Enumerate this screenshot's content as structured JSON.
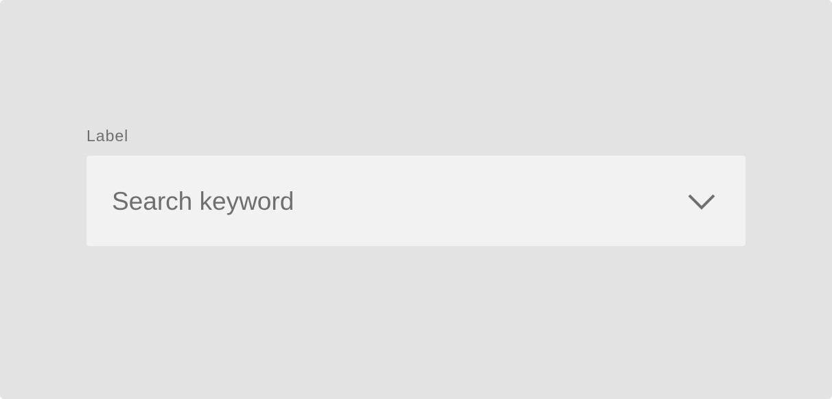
{
  "field": {
    "label": "Label",
    "placeholder": "Search keyword"
  },
  "icons": {
    "dropdown": "chevron-down-icon"
  },
  "colors": {
    "background": "#e3e3e3",
    "field_background": "#f2f2f2",
    "text": "#6f6f6f"
  }
}
